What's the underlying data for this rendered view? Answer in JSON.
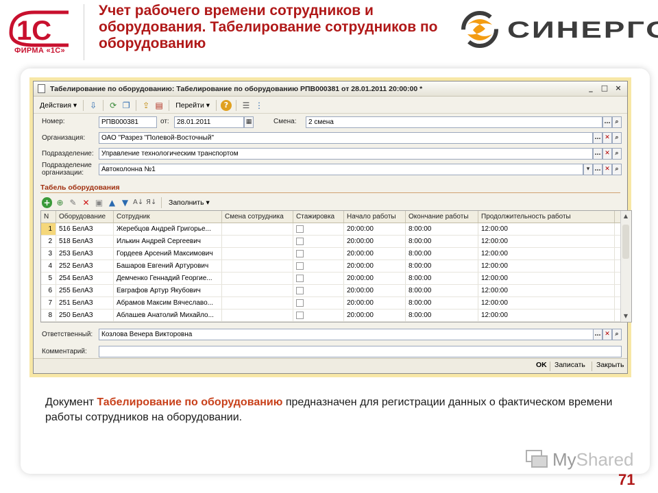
{
  "header": {
    "logo_1c_text": "1С",
    "logo_1c_caption": "ФИРМА «1С»",
    "slide_title": "Учет рабочего времени сотрудников и оборудования. Табелирование сотрудников по оборудованию",
    "brand_name": "СИНЕРГО",
    "accent_color": "#b01818"
  },
  "window": {
    "title": "Табелирование по оборудованию: Табелирование по оборудованию РПВ000381 от 28.01.2011 20:00:00 *",
    "controls": {
      "minimize": "_",
      "maximize": "□",
      "close": "×"
    },
    "toolbar": {
      "actions": "Действия ▾",
      "goto": "Перейти ▾",
      "help": "?"
    }
  },
  "form": {
    "number_label": "Номер:",
    "number_value": "РПВ000381",
    "date_label": "от:",
    "date_value": "28.01.2011",
    "shift_label": "Смена:",
    "shift_value": "2 смена",
    "org_label": "Организация:",
    "org_value": "ОАО \"Разрез \"Полевой-Восточный\"",
    "division_label": "Подразделение:",
    "division_value": "Управление технологическим транспортом",
    "org_division_label_1": "Подразделение",
    "org_division_label_2": "организации:",
    "org_division_value": "Автоколонна №1",
    "responsible_label": "Ответственный:",
    "responsible_value": "Козлова Венера Викторовна",
    "comment_label": "Комментарий:",
    "comment_value": ""
  },
  "table_section": {
    "title": "Табель оборудования",
    "fill_button": "Заполнить ▾",
    "columns": [
      "N",
      "Оборудование",
      "Сотрудник",
      "Смена сотрудника",
      "Стажировка",
      "Начало работы",
      "Окончание работы",
      "Продолжительность работы"
    ],
    "rows": [
      [
        "1",
        "516 БелАЗ",
        "Жеребцов Андрей Григорье...",
        "",
        "",
        "20:00:00",
        "8:00:00",
        "12:00:00"
      ],
      [
        "2",
        "518 БелАЗ",
        "Илькин Андрей Сергеевич",
        "",
        "",
        "20:00:00",
        "8:00:00",
        "12:00:00"
      ],
      [
        "3",
        "253 БелАЗ",
        "Гордеев Арсений Максимович",
        "",
        "",
        "20:00:00",
        "8:00:00",
        "12:00:00"
      ],
      [
        "4",
        "252 БелАЗ",
        "Башаров Евгений Артурович",
        "",
        "",
        "20:00:00",
        "8:00:00",
        "12:00:00"
      ],
      [
        "5",
        "254 БелАЗ",
        "Демченко Геннадий Георгие...",
        "",
        "",
        "20:00:00",
        "8:00:00",
        "12:00:00"
      ],
      [
        "6",
        "255 БелАЗ",
        "Евграфов Артур Якубович",
        "",
        "",
        "20:00:00",
        "8:00:00",
        "12:00:00"
      ],
      [
        "7",
        "251 БелАЗ",
        "Абрамов Максим Вячеславо...",
        "",
        "",
        "20:00:00",
        "8:00:00",
        "12:00:00"
      ],
      [
        "8",
        "250 БелАЗ",
        "Аблашев Анатолий Михайло...",
        "",
        "",
        "20:00:00",
        "8:00:00",
        "12:00:00"
      ]
    ]
  },
  "buttons": {
    "ok": "OK",
    "save": "Записать",
    "close": "Закрыть"
  },
  "description": {
    "before": "Документ ",
    "highlight": "Табелирование по оборудованию",
    "after": " предназначен для регистрации данных о фактическом времени работы сотрудников на оборудовании."
  },
  "footer": {
    "watermark_my": "My",
    "watermark_shared": "Shared",
    "page_number": "71"
  }
}
